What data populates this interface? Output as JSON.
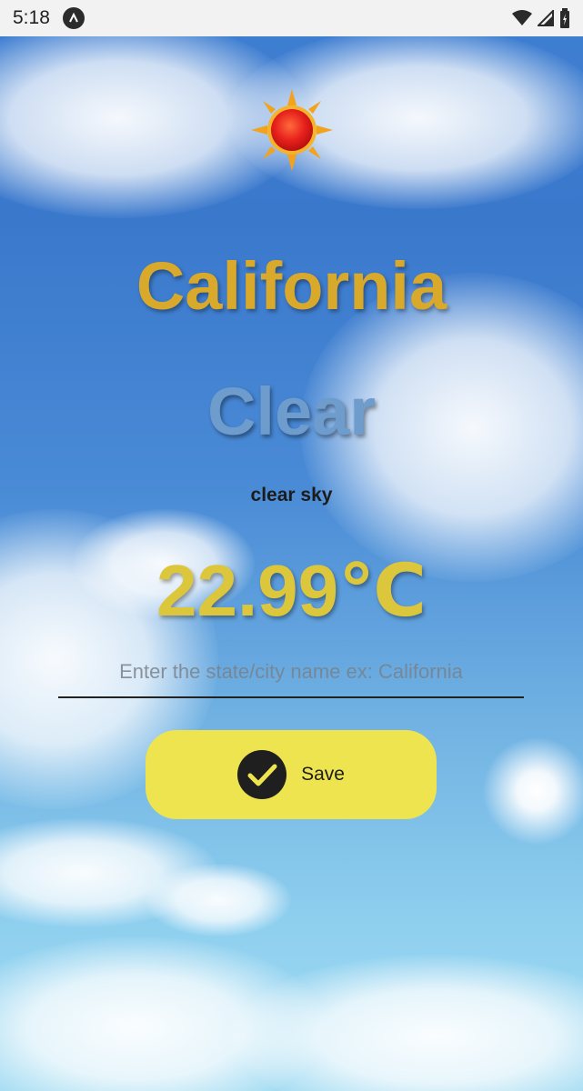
{
  "status_bar": {
    "time": "5:18",
    "app_icon": "android-studio-icon",
    "icons": [
      "wifi-icon",
      "signal-icon",
      "battery-icon"
    ]
  },
  "weather": {
    "weather_icon": "sun-icon",
    "city": "California",
    "condition": "Clear",
    "description": "clear sky",
    "temperature": "22.99℃"
  },
  "input": {
    "value": "",
    "placeholder": "Enter the state/city name ex: California"
  },
  "save_button": {
    "label": "Save",
    "icon": "check-icon",
    "color": "#eee44f"
  },
  "colors": {
    "city": "#d8a92a",
    "condition": "#6d9ccd",
    "temperature": "#dcc63c"
  }
}
